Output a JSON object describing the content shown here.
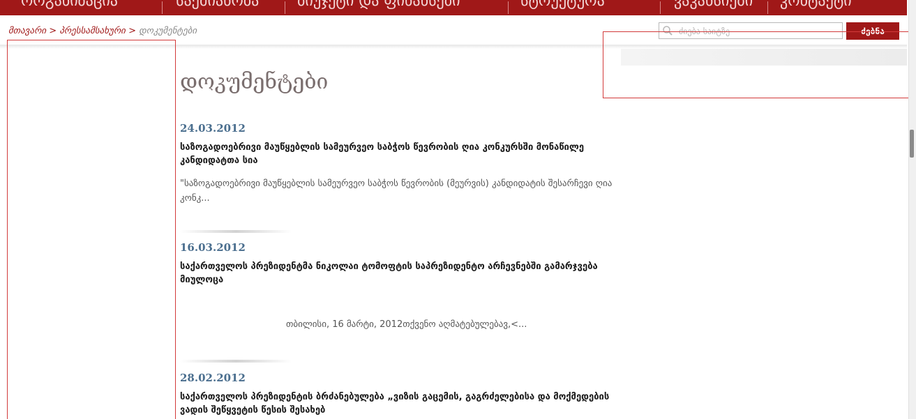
{
  "top_nav": {
    "items": [
      "ორგანიზაცია",
      "საქმიანობა",
      "ბიუჯეტი და ფინანსები",
      "სტრუქტურა",
      "ვაკანსიები",
      "კონტაქტი"
    ]
  },
  "breadcrumb": {
    "home": "მთავარი",
    "section": "პრესსამსახური",
    "current": "დოკუმენტები",
    "separator": ">"
  },
  "search": {
    "placeholder": "ძიება საიტზე",
    "button_label": "ძებნა"
  },
  "page_title": "დოკუმენტები",
  "articles": [
    {
      "date": "24.03.2012",
      "title": "საზოგადოებრივი მაუწყებლის სამეურვეო საბჭოს წევრობის ღია კონკურსში მონაწილე კანდიდატთა სია",
      "excerpt": "\"საზოგადოებრივი მაუწყებლის სამეურვეო საბჭოს წევრობის (მეურვის) კანდიდატის შესარჩევი ღია კონკ..."
    },
    {
      "date": "16.03.2012",
      "title": "საქართველოს პრეზიდენტმა ნიკოლაი ტომოფტის საპრეზიდენტო არჩევნებში გამარჯვება მიულოცა",
      "excerpt": "თბილისი, 16 მარტი, 2012თქვენო აღმატებულებავ,<..."
    },
    {
      "date": "28.02.2012",
      "title": "საქართველოს პრეზიდენტის ბრძანებულება „ვიზის გაცემის, გაგრძელებისა და მოქმედების ვადის შეწყვეტის წესის შესახებ",
      "excerpt": ""
    }
  ],
  "colors": {
    "brand_red": "#a01818",
    "date_blue": "#4a6e8e",
    "annotation_red": "#d23a3a"
  }
}
